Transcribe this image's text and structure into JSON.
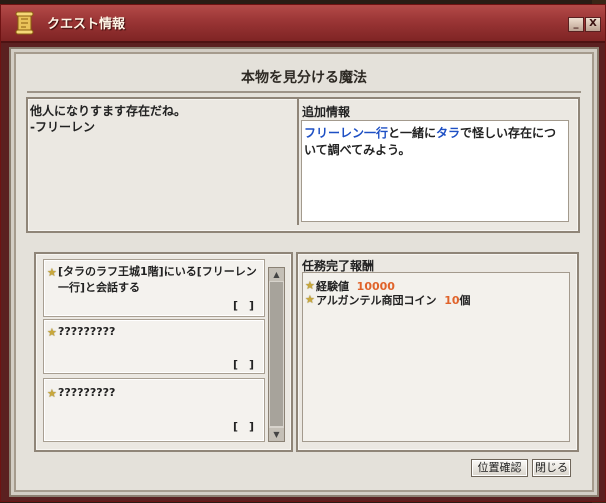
{
  "window": {
    "title": "クエスト情報",
    "minimize": "_",
    "close": "X"
  },
  "quest": {
    "title": "本物を見分ける魔法"
  },
  "description": "他人になりすます存在だね。\n-フリーレン",
  "additional": {
    "header": "追加情報",
    "parts": [
      "フリーレン一行",
      "と一緒に",
      "タラ",
      "で怪しい存在について調べてみよう。"
    ]
  },
  "objectives": [
    {
      "text": "[タラのラフ王城1階]にいる[フリーレン一行]と会話する",
      "progress": "[　]"
    },
    {
      "text": "?????????",
      "progress": "[　]"
    },
    {
      "text": "?????????",
      "progress": "[　]"
    }
  ],
  "rewards": {
    "header": "任務完了報酬",
    "items": [
      {
        "label": "経験値",
        "value": "10000",
        "suffix": ""
      },
      {
        "label": "アルガンテル商団コイン",
        "value": "10",
        "suffix": "個"
      }
    ]
  },
  "buttons": {
    "locate": "位置確認",
    "close": "閉じる"
  },
  "icons": {
    "title": "scroll-icon",
    "bullet": "star-icon"
  },
  "colors": {
    "accent_blue": "#1d4fc4",
    "reward_orange": "#e0632a",
    "titlebar": "#9a3535"
  }
}
